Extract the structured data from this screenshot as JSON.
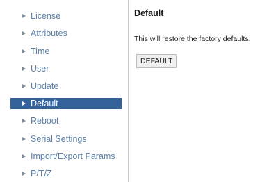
{
  "sidebar": {
    "items": [
      {
        "label": "License",
        "selected": false
      },
      {
        "label": "Attributes",
        "selected": false
      },
      {
        "label": "Time",
        "selected": false
      },
      {
        "label": "User",
        "selected": false
      },
      {
        "label": "Update",
        "selected": false
      },
      {
        "label": "Default",
        "selected": true
      },
      {
        "label": "Reboot",
        "selected": false
      },
      {
        "label": "Serial Settings",
        "selected": false
      },
      {
        "label": "Import/Export Params",
        "selected": false
      },
      {
        "label": "P/T/Z",
        "selected": false
      }
    ]
  },
  "main": {
    "title": "Default",
    "description": "This will restore the factory defaults.",
    "button_label": "DEFAULT"
  },
  "colors": {
    "selected_background": "#35619a",
    "link_text": "#5a7fa6"
  }
}
